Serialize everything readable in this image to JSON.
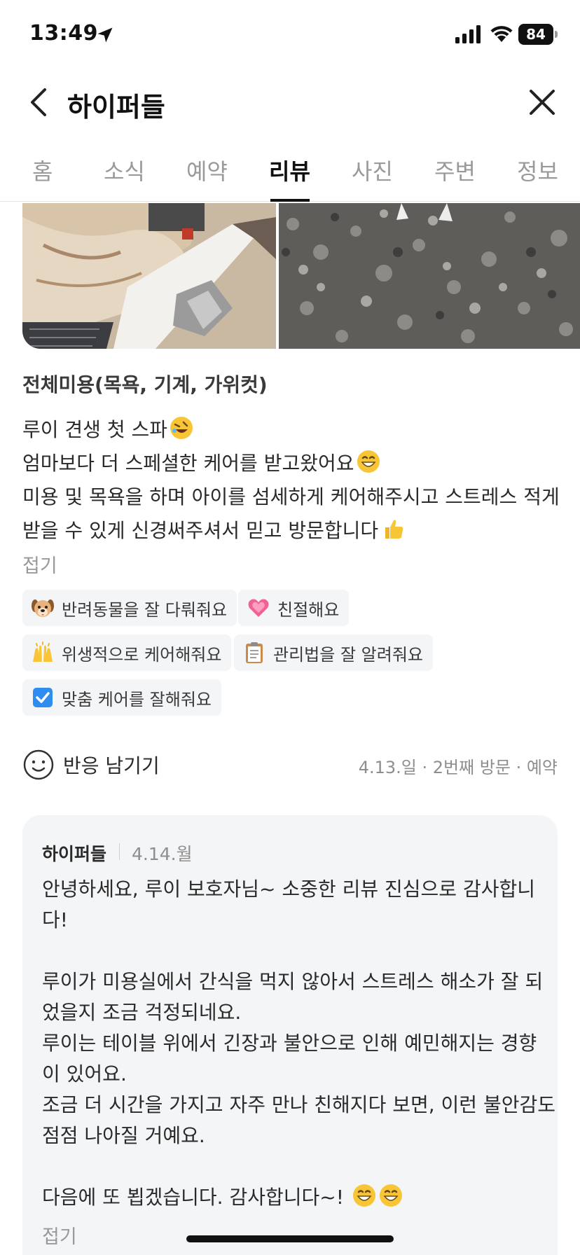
{
  "status_bar": {
    "time": "13:49",
    "battery": "84"
  },
  "header": {
    "title": "하이퍼들"
  },
  "tabs": [
    {
      "label": "홈"
    },
    {
      "label": "소식"
    },
    {
      "label": "예약"
    },
    {
      "label": "리뷰"
    },
    {
      "label": "사진"
    },
    {
      "label": "주변"
    },
    {
      "label": "정보"
    }
  ],
  "active_tab": "리뷰",
  "review": {
    "service": "전체미용(목욕, 기계, 가위컷)",
    "lines": [
      "루이 견생 첫 스파",
      "엄마보다 더 스페셜한 케어를 받고왔어요",
      "미용 및 목욕을 하며 아이를 섬세하게 케어해주시고 스트레스 적게",
      "받을 수 있게 신경써주셔서 믿고 방문합니다"
    ],
    "fold_label": "접기",
    "keywords": [
      {
        "label": "반려동물을 잘 다뤄줘요",
        "icon": "dog-face-icon"
      },
      {
        "label": "친절해요",
        "icon": "growing-heart-icon"
      },
      {
        "label": "위생적으로 케어해줘요",
        "icon": "raised-hands-icon"
      },
      {
        "label": "관리법을 잘 알려줘요",
        "icon": "clipboard-icon"
      },
      {
        "label": "맞춤 케어를 잘해줘요",
        "icon": "check-box-icon"
      }
    ],
    "reaction_label": "반응 남기기",
    "visit_meta": "4.13.일 · 2번째 방문 · 예약"
  },
  "reply": {
    "author": "하이퍼들",
    "date": "4.14.월",
    "lines": [
      "안녕하세요, 루이 보호자님~ 소중한 리뷰 진심으로 감사합니",
      "다!",
      "",
      "루이가 미용실에서 간식을 먹지 않아서 스트레스 해소가 잘 되",
      "었을지 조금 걱정되네요.",
      "루이는 테이블 위에서 긴장과 불안으로 인해 예민해지는 경향",
      "이 있어요.",
      "조금 더 시간을 가지고 자주 만나 친해지다 보면, 이런 불안감도",
      "점점 나아질 거예요.",
      "",
      "다음에 또 뵙겠습니다. 감사합니다~!"
    ],
    "fold_label": "접기"
  }
}
